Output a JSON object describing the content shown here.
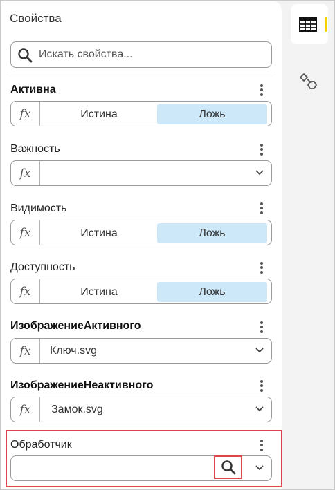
{
  "panel": {
    "title": "Свойства",
    "search": {
      "placeholder": "Искать свойства..."
    }
  },
  "properties": [
    {
      "label": "Активна",
      "bold": true,
      "type": "toggle",
      "true_label": "Истина",
      "false_label": "Ложь",
      "selected": "false"
    },
    {
      "label": "Важность",
      "bold": false,
      "type": "dropdown",
      "value": ""
    },
    {
      "label": "Видимость",
      "bold": false,
      "type": "toggle",
      "true_label": "Истина",
      "false_label": "Ложь",
      "selected": "false"
    },
    {
      "label": "Доступность",
      "bold": false,
      "type": "toggle",
      "true_label": "Истина",
      "false_label": "Ложь",
      "selected": "false"
    },
    {
      "label": "ИзображениеАктивного",
      "bold": true,
      "type": "dropdown",
      "value": "Ключ.svg"
    },
    {
      "label": "ИзображениеНеактивного",
      "bold": true,
      "type": "dropdown",
      "value": "Замок.svg"
    },
    {
      "label": "Обработчик",
      "bold": false,
      "type": "search-dropdown",
      "value": ""
    }
  ],
  "fx_label": "fx",
  "colors": {
    "selected_segment": "#cde8f8",
    "highlight": "#e0444c",
    "active_tab_indicator": "#f6d300"
  },
  "rail": [
    {
      "icon": "table-icon",
      "active": true
    },
    {
      "icon": "shapes-icon",
      "active": false
    }
  ]
}
